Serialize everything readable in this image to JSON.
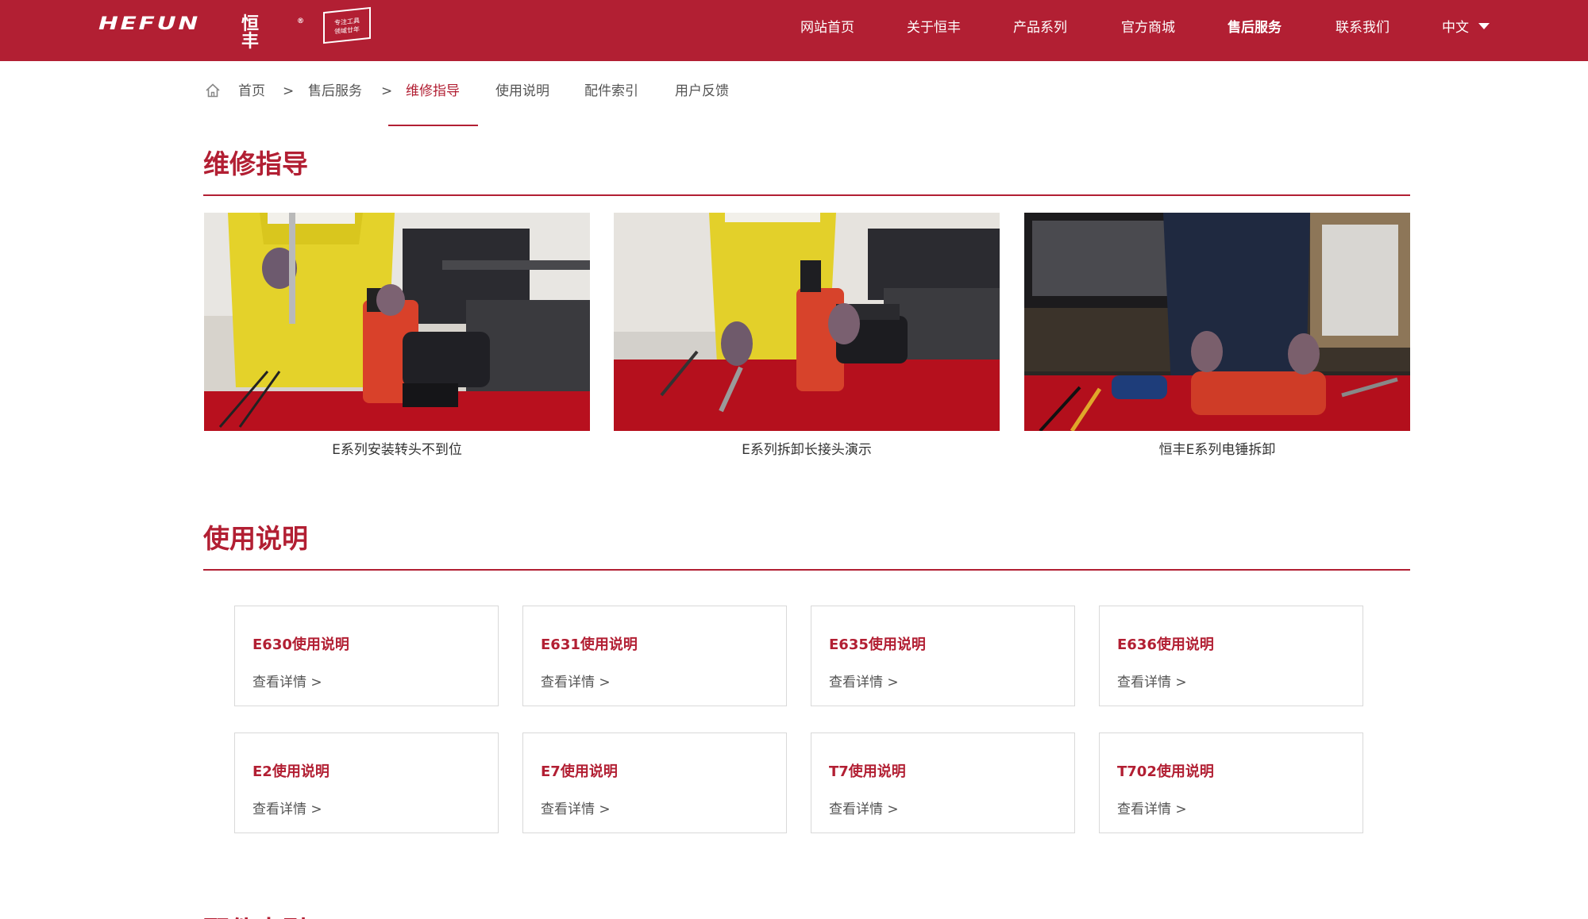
{
  "header": {
    "logo_text": "HEFUN",
    "logo_cn": "恒丰",
    "logo_reg": "®",
    "badge_line1": "专注工具",
    "badge_line2": "领域廿年",
    "nav": [
      {
        "label": "网站首页"
      },
      {
        "label": "关于恒丰"
      },
      {
        "label": "产品系列"
      },
      {
        "label": "官方商城"
      },
      {
        "label": "售后服务"
      },
      {
        "label": "联系我们"
      },
      {
        "label": "中文"
      }
    ],
    "active_nav": "售后服务"
  },
  "breadcrumb": {
    "home": "首页",
    "sep": ">",
    "service": "售后服务",
    "current": "维修指导",
    "tabs": [
      "使用说明",
      "配件索引",
      "用户反馈"
    ]
  },
  "repair": {
    "title": "维修指导",
    "videos": [
      {
        "caption": "E系列安装转头不到位"
      },
      {
        "caption": "E系列拆卸长接头演示"
      },
      {
        "caption": "恒丰E系列电锤拆卸"
      }
    ]
  },
  "manuals": {
    "title": "使用说明",
    "link_label": "查看详情 >",
    "items": [
      {
        "title": "E630使用说明"
      },
      {
        "title": "E631使用说明"
      },
      {
        "title": "E635使用说明"
      },
      {
        "title": "E636使用说明"
      },
      {
        "title": "E2使用说明"
      },
      {
        "title": "E7使用说明"
      },
      {
        "title": "T7使用说明"
      },
      {
        "title": "T702使用说明"
      }
    ]
  },
  "next_section": {
    "title": "配件索引"
  },
  "colors": {
    "brand": "#b21f33",
    "card_border": "#d9d9d9"
  }
}
